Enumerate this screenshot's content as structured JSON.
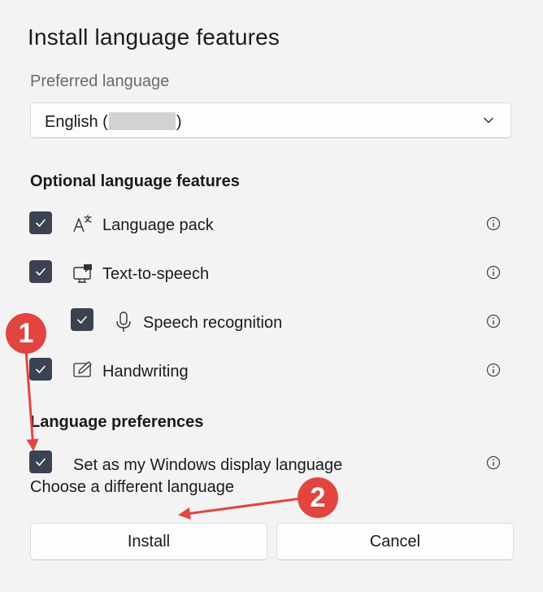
{
  "dialog": {
    "title": "Install language features",
    "preferred_label": "Preferred language",
    "select": {
      "value_prefix": "English (",
      "value_suffix": ")"
    },
    "optional_heading": "Optional language features",
    "features": [
      {
        "label": "Language pack",
        "checked": true,
        "icon": "language-pack-icon"
      },
      {
        "label": "Text-to-speech",
        "checked": true,
        "icon": "text-to-speech-icon"
      },
      {
        "label": "Speech recognition",
        "checked": true,
        "icon": "microphone-icon"
      },
      {
        "label": "Handwriting",
        "checked": true,
        "icon": "pen-icon"
      }
    ],
    "preferences_heading": "Language preferences",
    "display_language_label": "Set as my Windows display language",
    "choose_link": "Choose a different language",
    "buttons": {
      "install": "Install",
      "cancel": "Cancel"
    }
  },
  "annotations": {
    "badge_1": "1",
    "badge_2": "2",
    "color": "#e2453f"
  },
  "colors": {
    "checkbox": "#3b4252",
    "background": "#f3f3f3"
  }
}
